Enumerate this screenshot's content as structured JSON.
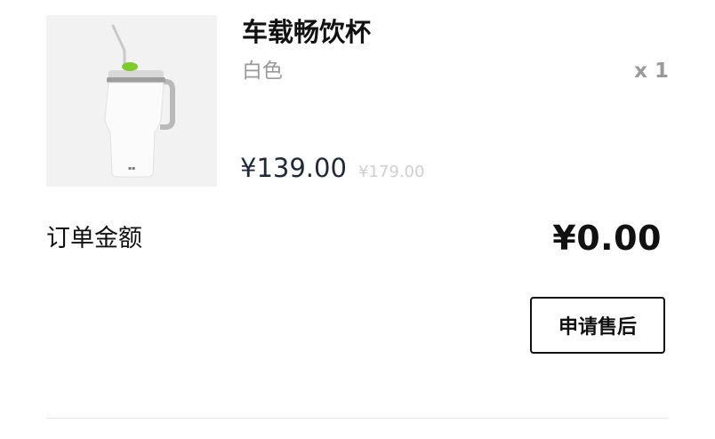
{
  "product": {
    "name": "车载畅饮杯",
    "variant": "白色",
    "quantity": "x 1",
    "price": "¥139.00",
    "original_price": "¥179.00",
    "image_icon": "tumbler-cup-image"
  },
  "order": {
    "total_label": "订单金额",
    "total_value": "¥0.00"
  },
  "actions": {
    "after_sale_label": "申请售后"
  },
  "colors": {
    "accent_lid": "#7dcb2b",
    "price": "#1f2a38",
    "muted": "#9a9a9a"
  }
}
